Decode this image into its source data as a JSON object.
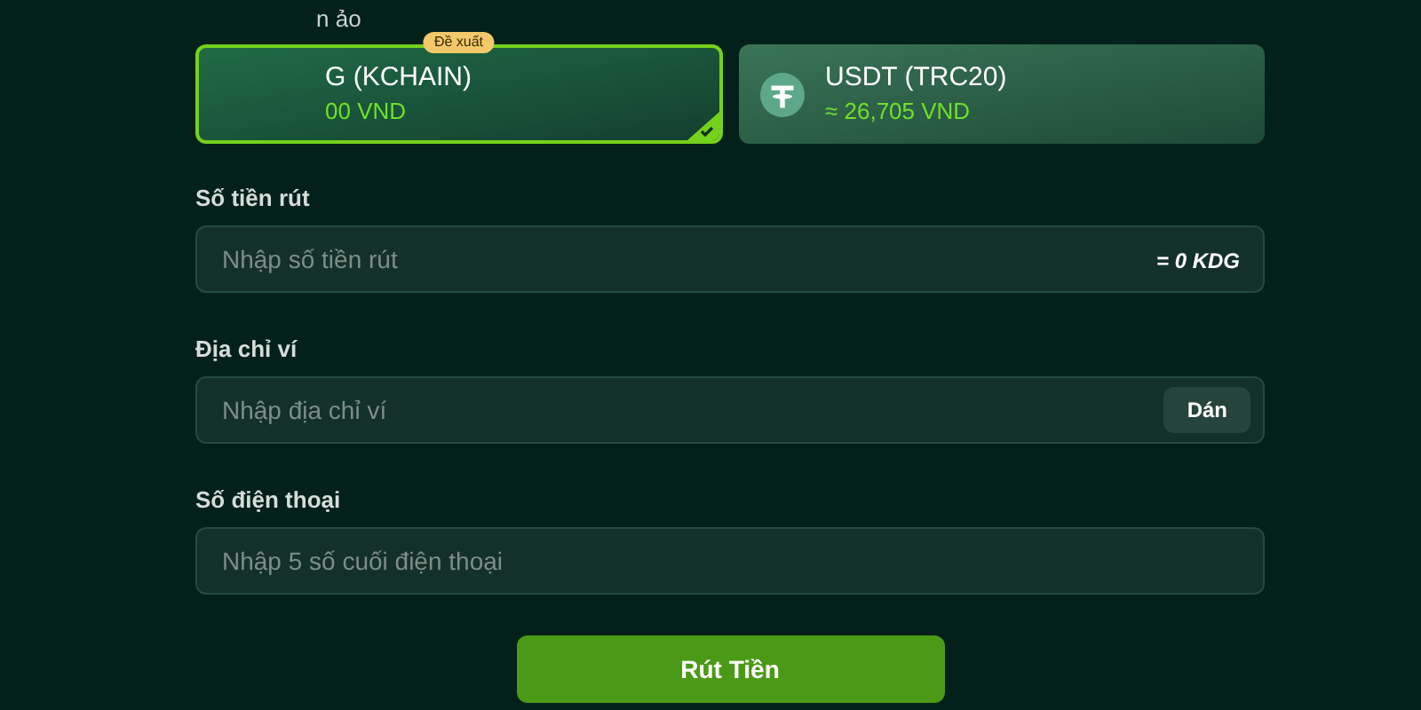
{
  "section_label": "n ảo",
  "methods": [
    {
      "name": "G (KCHAIN)",
      "rate": "00 VND",
      "badge": "Đề xuất",
      "selected": true,
      "icon": false
    },
    {
      "name": "USDT (TRC20)",
      "rate": "≈ 26,705 VND",
      "selected": false,
      "icon": true
    }
  ],
  "fields": [
    {
      "label": "Số tiền rút",
      "placeholder": "Nhập số tiền rút",
      "kind": "suffix",
      "suffix": "= 0 KDG"
    },
    {
      "label": "Địa chỉ ví",
      "placeholder": "Nhập địa chỉ ví",
      "kind": "button",
      "button": "Dán"
    },
    {
      "label": "Số điện thoại",
      "placeholder": "Nhập 5 số cuối điện thoại",
      "kind": "plain"
    }
  ],
  "submit": "Rút Tiền"
}
